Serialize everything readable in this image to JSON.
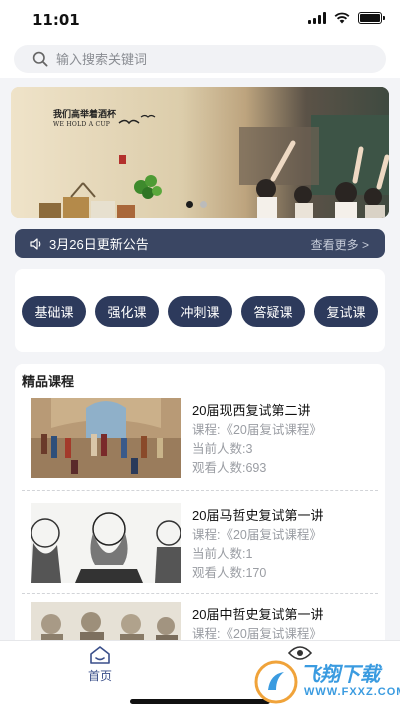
{
  "status_bar": {
    "time": "11:01"
  },
  "search": {
    "placeholder": "输入搜索关键词"
  },
  "banner": {
    "title_cn": "我们高举着酒杯",
    "title_en": "WE HOLD A CUP",
    "pager": {
      "count": 2,
      "active": 0
    }
  },
  "notice": {
    "text": "3月26日更新公告",
    "more": "查看更多 >"
  },
  "categories": [
    "基础课",
    "强化课",
    "冲刺课",
    "答疑课",
    "复试课"
  ],
  "courses": {
    "heading": "精品课程",
    "items": [
      {
        "title": "20届现西复试第二讲",
        "course": "课程:《20届复试课程》",
        "current": "当前人数:3",
        "views": "观看人数:693"
      },
      {
        "title": "20届马哲史复试第一讲",
        "course": "课程:《20届复试课程》",
        "current": "当前人数:1",
        "views": "观看人数:170"
      },
      {
        "title": "20届中哲史复试第一讲",
        "course": "课程:《20届复试课程》",
        "current": "",
        "views": ""
      }
    ]
  },
  "tabbar": {
    "items": [
      {
        "label": "首页",
        "icon": "home-icon",
        "active": true
      },
      {
        "label": "",
        "icon": "eye-icon",
        "active": false
      }
    ],
    "active_color": "#3a4f8a"
  },
  "watermark": {
    "text": "飞翔下载",
    "url": "WWW.FXXZ.COM"
  }
}
